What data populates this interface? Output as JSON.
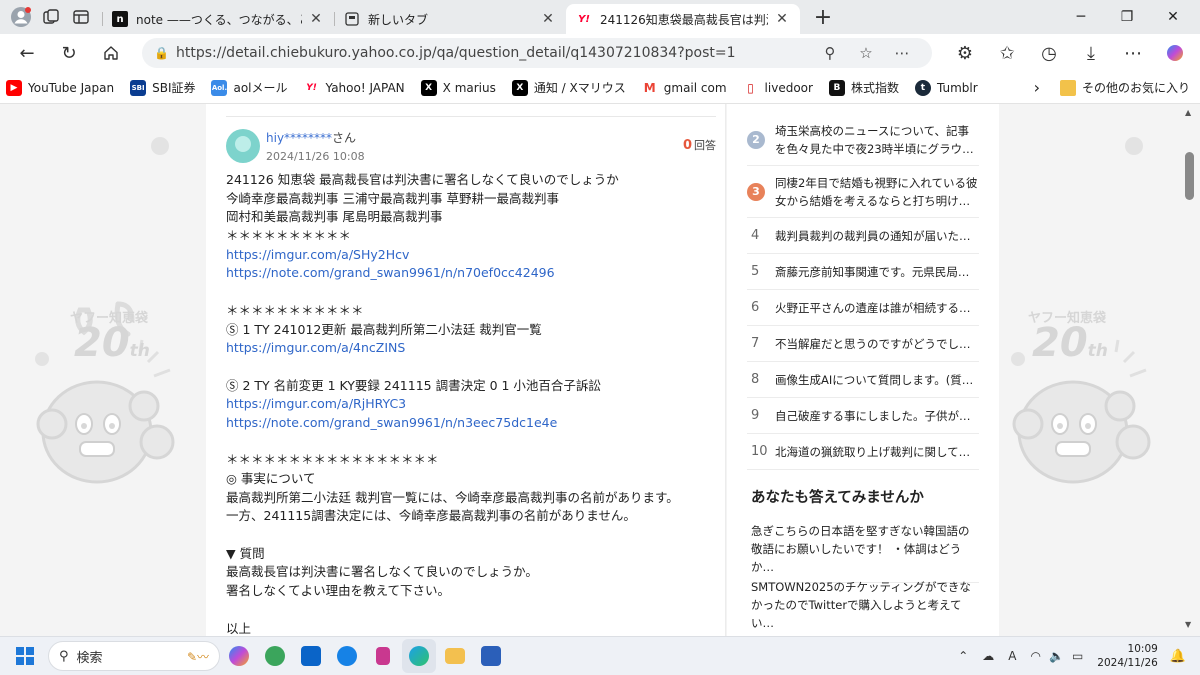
{
  "browser": {
    "tabs": [
      {
        "title": "note ——つくる、つながる、とどける。",
        "favicon": "n",
        "active": false
      },
      {
        "title": "新しいタブ",
        "favicon": "newtab",
        "active": false
      },
      {
        "title": "241126知恵袋最高裁長官は判決書",
        "favicon": "Y!",
        "active": true
      }
    ],
    "url": "https://detail.chiebukuro.yahoo.co.jp/qa/question_detail/q14307210834?post=1",
    "bookmarks": [
      {
        "label": "YouTube Japan",
        "icon": "youtube-icon",
        "color": "#ff0000"
      },
      {
        "label": "SBI証券",
        "icon": "sbi-icon",
        "color": "#0a3d91"
      },
      {
        "label": "aolメール",
        "icon": "aol-icon",
        "color": "#3a8be8"
      },
      {
        "label": "Yahoo! JAPAN",
        "icon": "yahoo-icon",
        "color": "#ff0033"
      },
      {
        "label": "X marius",
        "icon": "x-icon",
        "color": "#000000"
      },
      {
        "label": "通知 / Xマリウス",
        "icon": "x-icon",
        "color": "#000000"
      },
      {
        "label": "gmail com",
        "icon": "gmail-icon",
        "color": "#ea4335"
      },
      {
        "label": "livedoor",
        "icon": "livedoor-icon",
        "color": "#d41b1b"
      },
      {
        "label": "株式指数",
        "icon": "b-icon",
        "color": "#111111"
      },
      {
        "label": "Tumblr",
        "icon": "tumblr-icon",
        "color": "#1b2a3a"
      }
    ],
    "other_favorites": "その他のお気に入り"
  },
  "question": {
    "user_name": "hiy********",
    "user_suffix": "さん",
    "date": "2024/11/26 10:08",
    "answer_count": "0",
    "answer_label": "回答",
    "lines": [
      {
        "text": "241126 知恵袋 最高裁長官は判決書に署名しなくて良いのでしょうか",
        "link": false
      },
      {
        "text": "今崎幸彦最高裁判事 三浦守最高裁判事 草野耕一最高裁判事",
        "link": false
      },
      {
        "text": "岡村和美最高裁判事 尾島明最高裁判事",
        "link": false
      },
      {
        "text": "＊＊＊＊＊＊＊＊＊＊",
        "link": false
      },
      {
        "text": "https://imgur.com/a/SHy2Hcv",
        "link": true
      },
      {
        "text": "https://note.com/grand_swan9961/n/n70ef0cc42496",
        "link": true
      },
      {
        "text": "",
        "link": false
      },
      {
        "text": "＊＊＊＊＊＊＊＊＊＊＊",
        "link": false
      },
      {
        "text": "Ⓢ 1 TY 241012更新 最高裁判所第二小法廷 裁判官一覧",
        "link": false
      },
      {
        "text": "https://imgur.com/a/4ncZINS",
        "link": true
      },
      {
        "text": "",
        "link": false
      },
      {
        "text": "Ⓢ 2 TY 名前変更 1 KY要録 241115 調書決定 0 1 小池百合子訴訟",
        "link": false
      },
      {
        "text": "https://imgur.com/a/RjHRYC3",
        "link": true
      },
      {
        "text": "https://note.com/grand_swan9961/n/n3eec75dc1e4e",
        "link": true
      },
      {
        "text": "",
        "link": false
      },
      {
        "text": "＊＊＊＊＊＊＊＊＊＊＊＊＊＊＊＊＊",
        "link": false
      },
      {
        "text": "◎ 事実について",
        "link": false
      },
      {
        "text": "最高裁判所第二小法廷 裁判官一覧には、今崎幸彦最高裁判事の名前があります。",
        "link": false
      },
      {
        "text": "一方、241115調書決定には、今崎幸彦最高裁判事の名前がありません。",
        "link": false
      },
      {
        "text": "",
        "link": false
      },
      {
        "text": "▼ 質問",
        "link": false
      },
      {
        "text": "最高裁長官は判決書に署名しなくて良いのでしょうか。",
        "link": false
      },
      {
        "text": "署名しなくてよい理由を教えて下さい。",
        "link": false
      },
      {
        "text": "",
        "link": false
      },
      {
        "text": "以上",
        "link": false
      }
    ]
  },
  "sidebar": {
    "ranking": [
      {
        "rank": "2",
        "text": "埼玉栄高校のニュースについて、記事を色々見た中で夜23時半頃にグラウ…",
        "badge_color": "#a9b9cf"
      },
      {
        "rank": "3",
        "text": "同棲2年目で結婚も視野に入れている彼女から結婚を考えるならと打ち明け…",
        "badge_color": "#e8825a"
      },
      {
        "rank": "4",
        "text": "裁判員裁判の裁判員の通知が届いた…"
      },
      {
        "rank": "5",
        "text": "斎藤元彦前知事関連です。元県民局…"
      },
      {
        "rank": "6",
        "text": "火野正平さんの遺産は誰が相続する…"
      },
      {
        "rank": "7",
        "text": "不当解雇だと思うのですがどうでし…"
      },
      {
        "rank": "8",
        "text": "画像生成AIについて質問します。(質…"
      },
      {
        "rank": "9",
        "text": "自己破産する事にしました。子供が…"
      },
      {
        "rank": "10",
        "text": "北海道の猟銃取り上げ裁判に関して…"
      }
    ],
    "suggest_title": "あなたも答えてみませんか",
    "suggestions": [
      "急ぎこちらの日本語を堅すぎない韓国語の敬語にお願いしたいです！ ・体調はどうか…",
      "SMTOWN2025のチケッティングができなかったのでTwitterで購入しようと考えてい…"
    ]
  },
  "mascot": {
    "brand": "ヤフー知恵袋",
    "anniv": "20",
    "suffix": "th"
  },
  "taskbar": {
    "search_placeholder": "検索",
    "apps": [
      "copilot-icon",
      "maps-icon",
      "outlook-icon",
      "messenger-icon",
      "snipping-icon",
      "edge-icon",
      "explorer-icon",
      "word-icon"
    ],
    "time": "10:09",
    "date": "2024/11/26",
    "ime": "A"
  }
}
